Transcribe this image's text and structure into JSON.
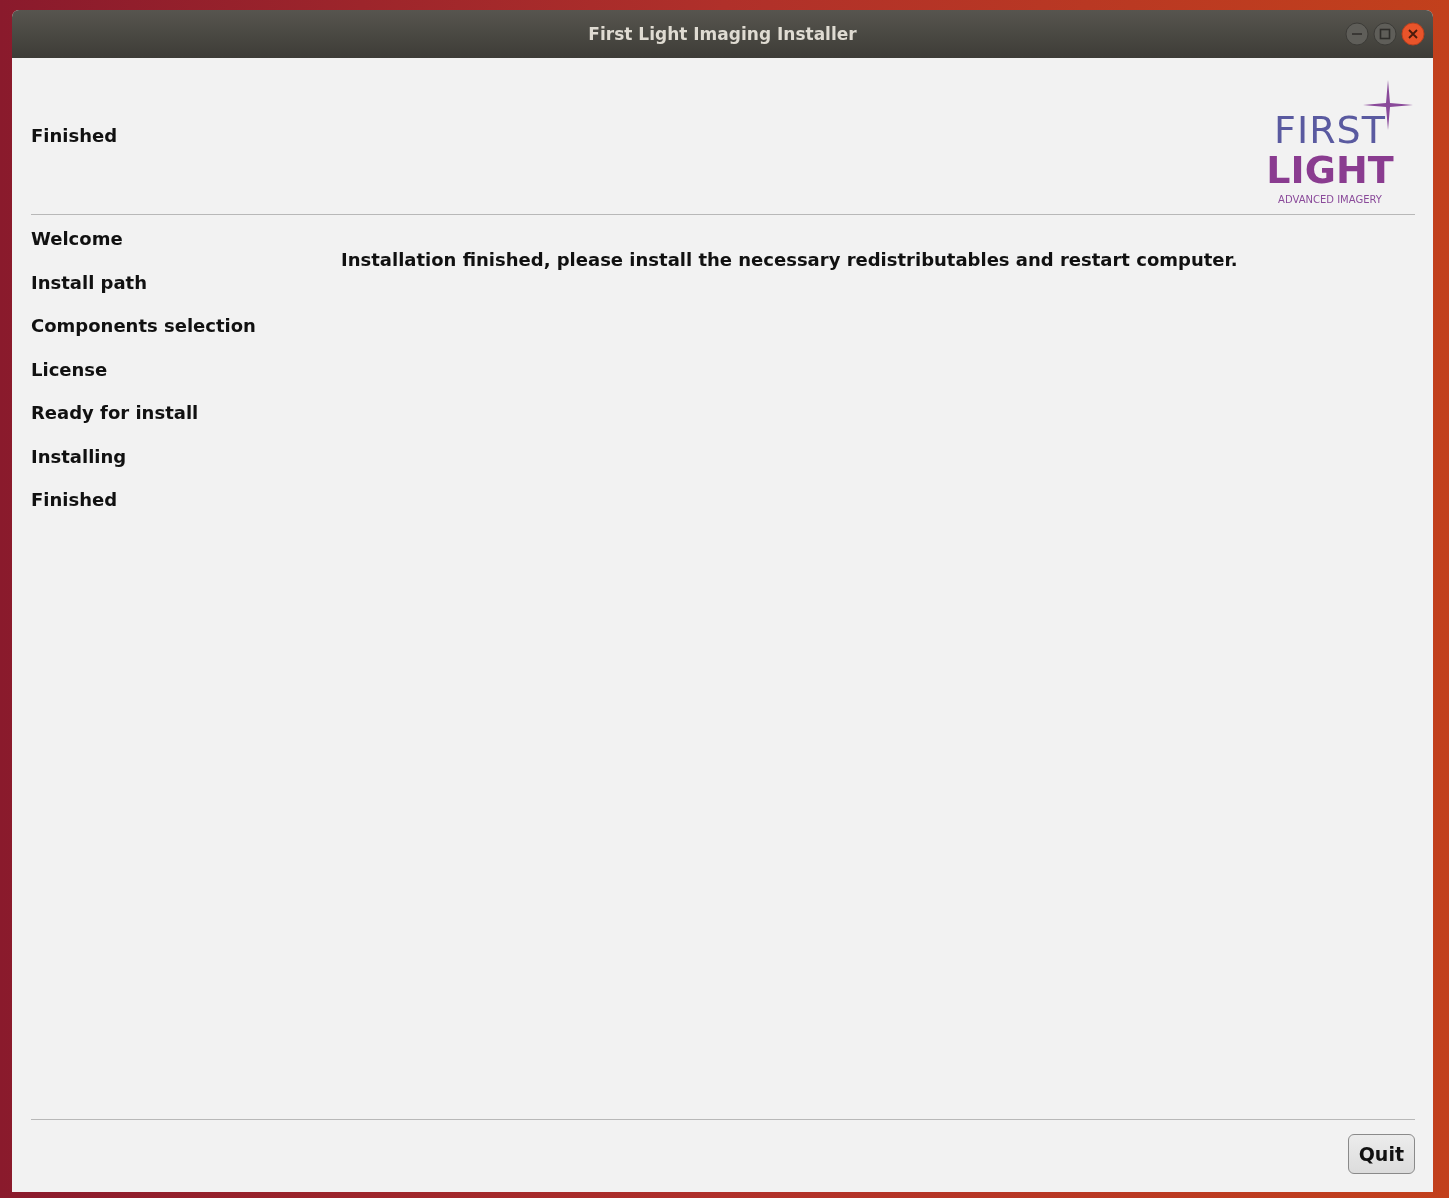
{
  "window": {
    "title": "First Light Imaging Installer"
  },
  "header": {
    "title": "Finished",
    "logo": {
      "line_1": "FIRST",
      "line_2": "LIGHT",
      "tagline": "ADVANCED IMAGERY"
    }
  },
  "steps": [
    {
      "label": "Welcome"
    },
    {
      "label": "Install path"
    },
    {
      "label": "Components selection"
    },
    {
      "label": "License"
    },
    {
      "label": "Ready for install"
    },
    {
      "label": "Installing"
    },
    {
      "label": "Finished"
    }
  ],
  "message": "Installation finished, please install the necessary redistributables and restart computer.",
  "buttons": [
    "Quit"
  ]
}
